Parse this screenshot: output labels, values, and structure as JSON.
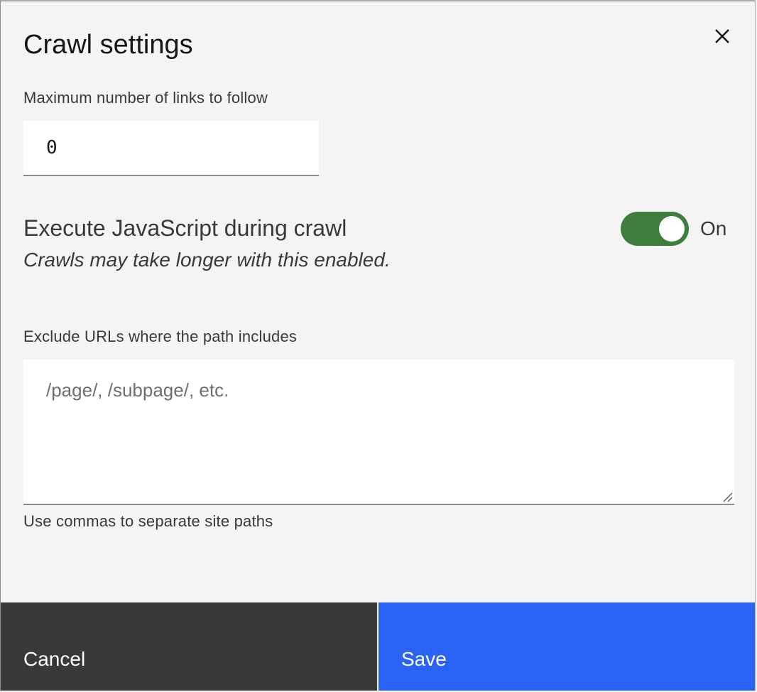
{
  "modal": {
    "title": "Crawl settings",
    "close_icon": "close-icon"
  },
  "max_links": {
    "label": "Maximum number of links to follow",
    "value": "0"
  },
  "javascript": {
    "title": "Execute JavaScript during crawl",
    "description": "Crawls may take longer with this enabled.",
    "state_label": "On",
    "enabled": true,
    "toggle_color": "#3d7d3d"
  },
  "exclude_urls": {
    "label": "Exclude URLs where the path includes",
    "value": "",
    "placeholder": "/page/, /subpage/, etc.",
    "helper": "Use commas to separate site paths"
  },
  "footer": {
    "cancel_label": "Cancel",
    "save_label": "Save",
    "cancel_color": "#393939",
    "save_color": "#2a62f4"
  }
}
